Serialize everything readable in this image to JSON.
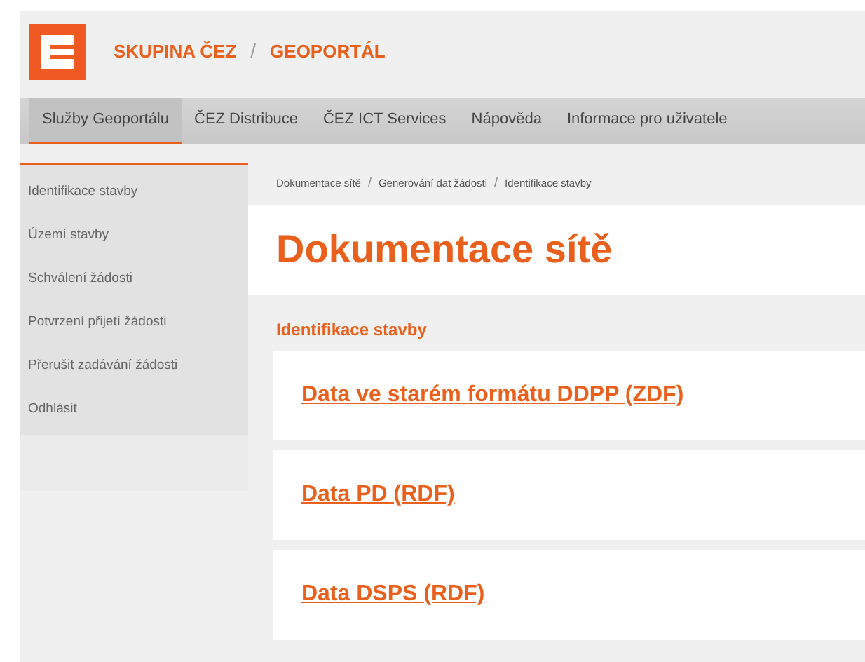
{
  "header": {
    "brand": "SKUPINA ČEZ",
    "separator": "/",
    "portal": "GEOPORTÁL"
  },
  "nav": [
    {
      "label": "Služby Geoportálu",
      "selected": true
    },
    {
      "label": "ČEZ Distribuce",
      "selected": false
    },
    {
      "label": "ČEZ ICT Services",
      "selected": false
    },
    {
      "label": "Nápověda",
      "selected": false
    },
    {
      "label": "Informace pro uživatele",
      "selected": false
    }
  ],
  "sidebar": {
    "items": [
      "Identifikace stavby",
      "Území stavby",
      "Schválení žádosti",
      "Potvrzení přijetí žádosti",
      "Přerušit zadávání žádosti",
      "Odhlásit"
    ]
  },
  "breadcrumbs": [
    {
      "label": "Dokumentace sítě"
    },
    {
      "separator": "/",
      "label": "Generování dat žádosti"
    },
    {
      "separator": "/",
      "label": "Identifikace stavby"
    }
  ],
  "page_title": "Dokumentace sítě",
  "section_title": "Identifikace stavby",
  "links": [
    "Data ve starém formátu DDPP (ZDF)",
    "Data PD (RDF)",
    "Data DSPS (RDF)"
  ]
}
